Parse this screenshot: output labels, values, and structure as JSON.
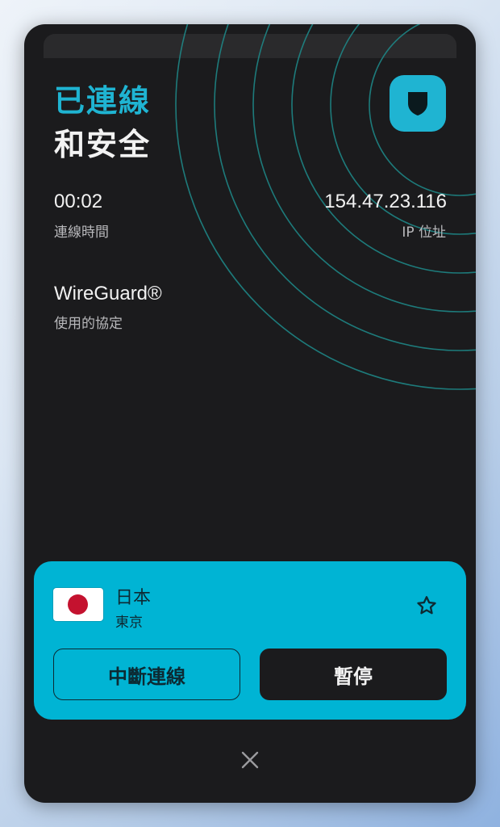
{
  "header": {
    "status_line1": "已連線",
    "status_line2": "和安全"
  },
  "stats": {
    "time_value": "00:02",
    "time_label": "連線時間",
    "ip_value": "154.47.23.116",
    "ip_label": "IP 位址",
    "protocol_value": "WireGuard®",
    "protocol_label": "使用的協定"
  },
  "location": {
    "country": "日本",
    "city": "東京",
    "flag_icon": "japan-flag-icon"
  },
  "actions": {
    "disconnect_label": "中斷連線",
    "pause_label": "暫停"
  },
  "colors": {
    "accent": "#1fb4d2",
    "panel": "#00b4d4",
    "card_bg": "#1b1b1d"
  },
  "icons": {
    "badge": "shield-icon",
    "favorite": "star-icon",
    "close": "close-icon"
  }
}
